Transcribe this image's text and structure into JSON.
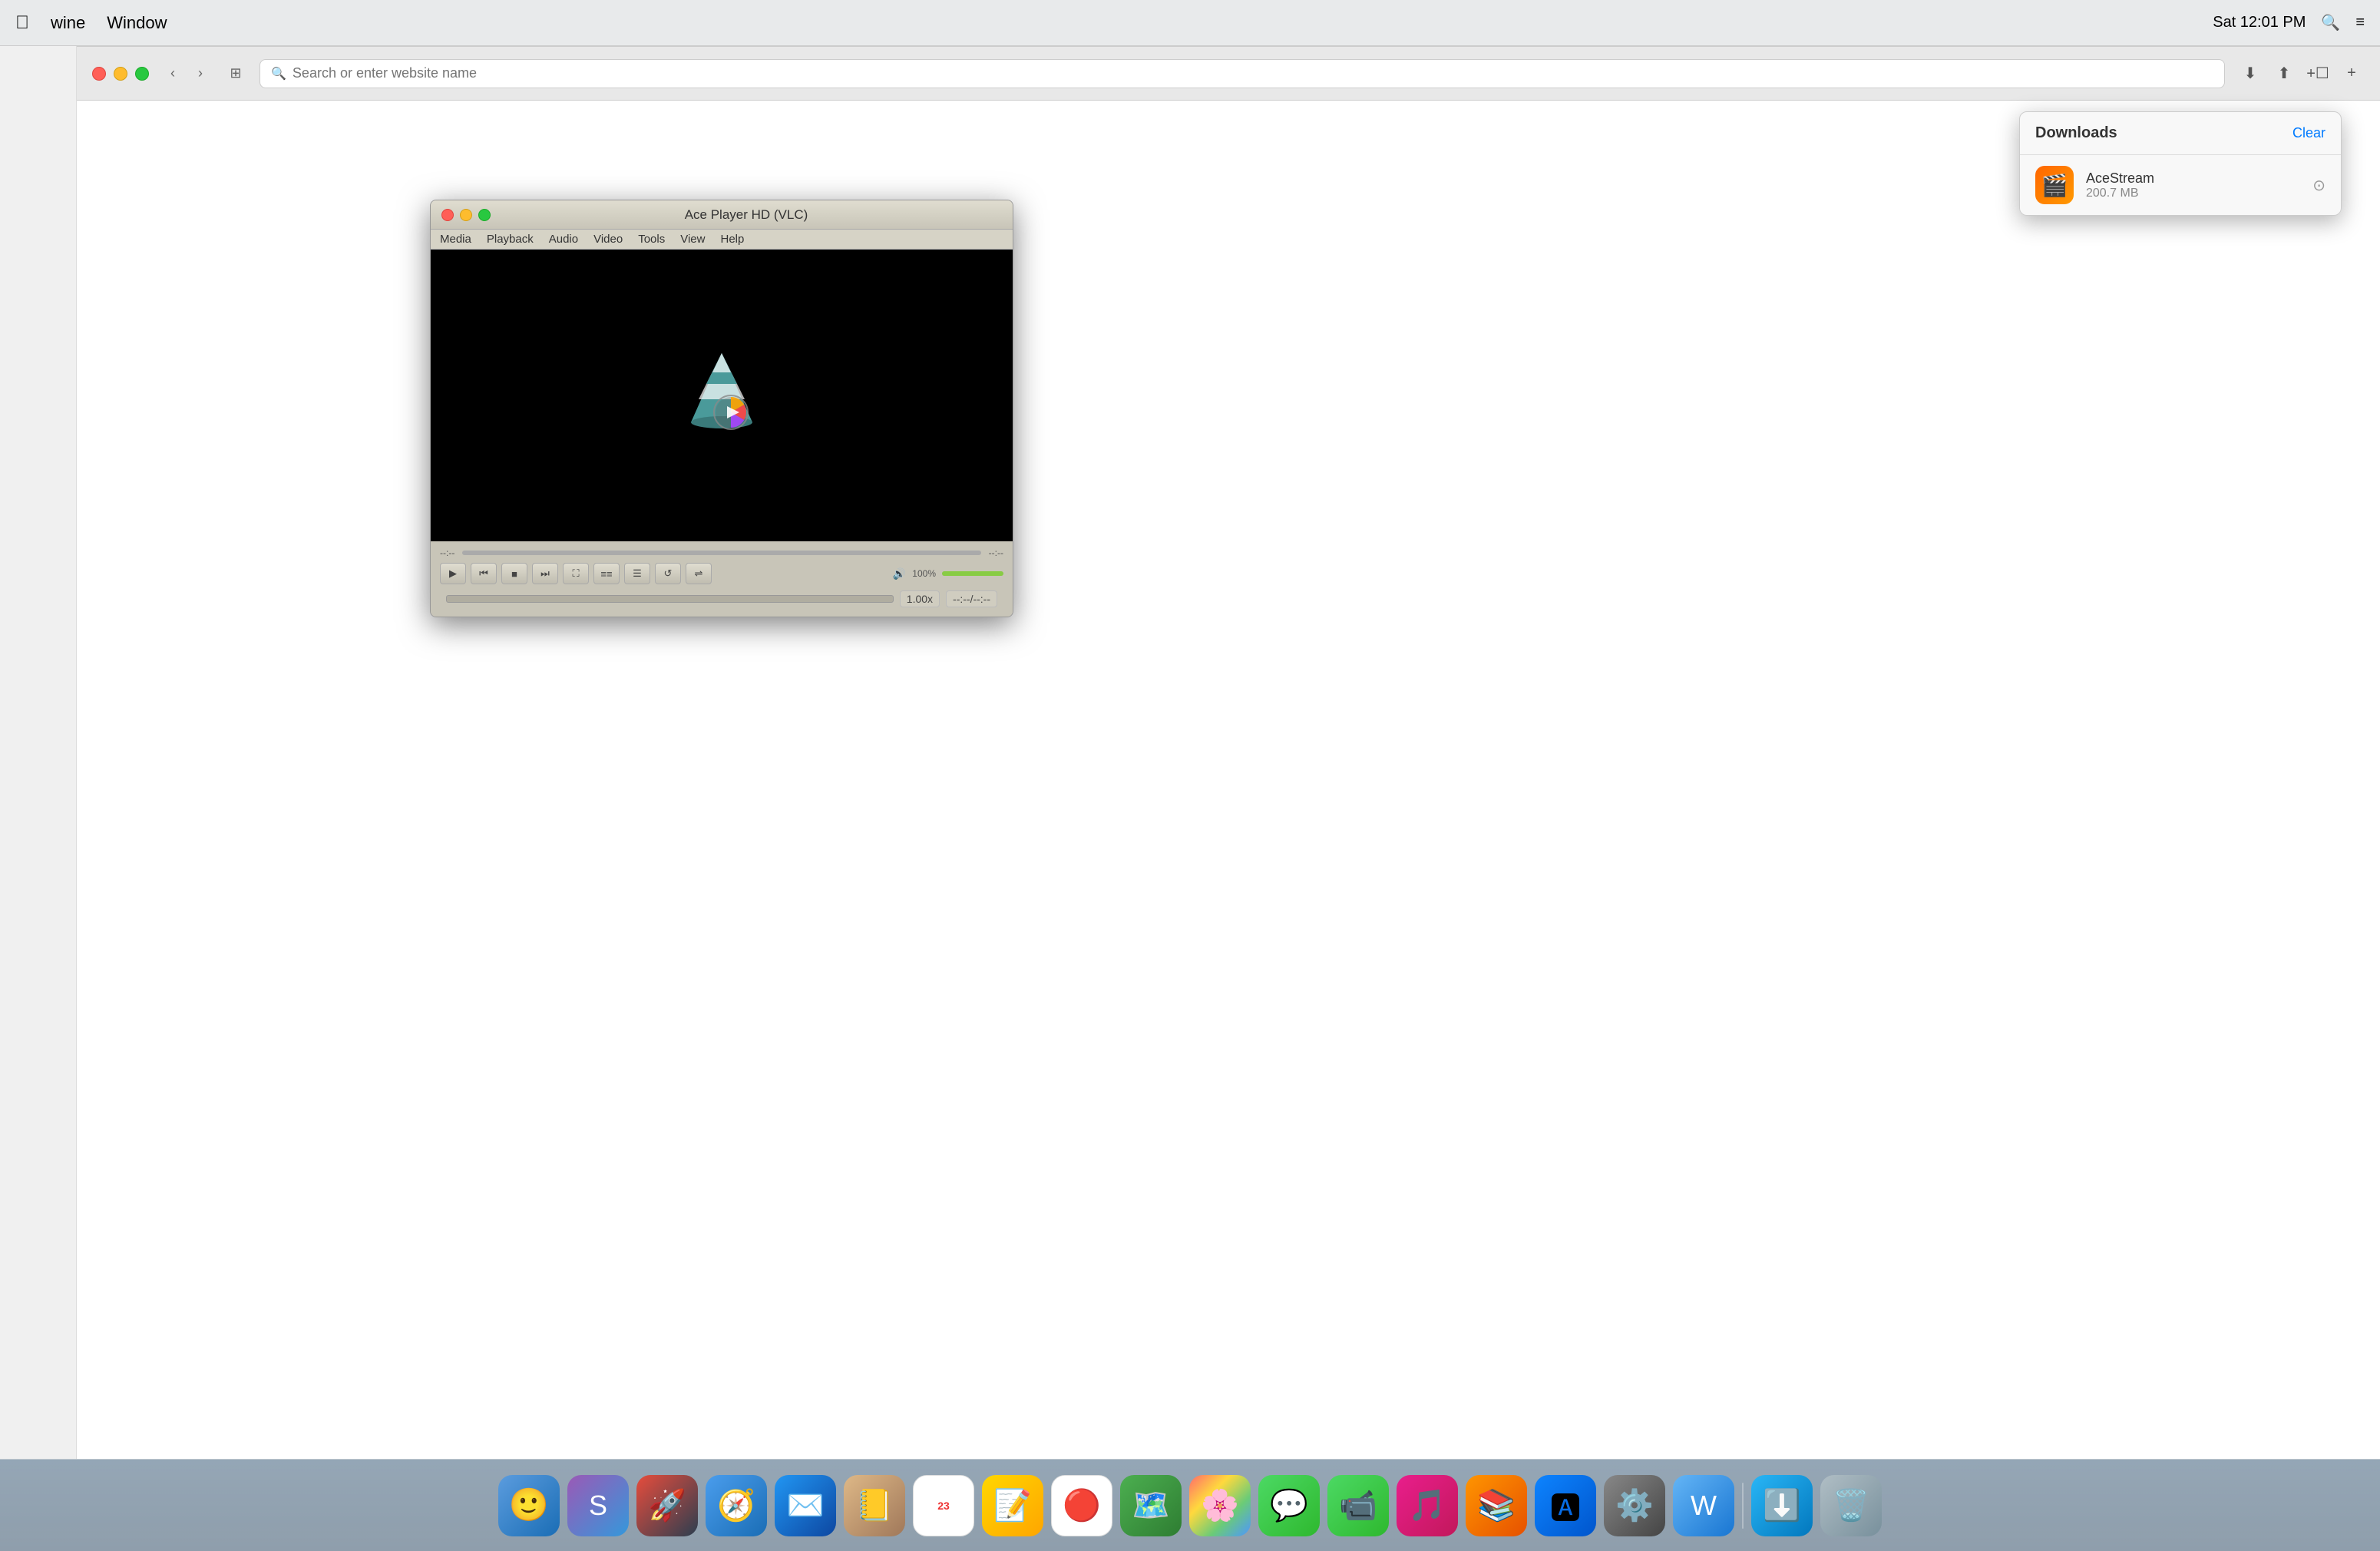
{
  "menubar": {
    "apple_label": "",
    "app_label": "wine",
    "window_label": "Window",
    "time": "Sat 12:01 PM"
  },
  "browser": {
    "search_placeholder": "Search or enter website name",
    "toolbar_buttons": {
      "back": "‹",
      "forward": "›",
      "sidebar": "⊞"
    }
  },
  "downloads": {
    "title": "Downloads",
    "clear_label": "Clear",
    "items": [
      {
        "name": "AceStream",
        "size": "200.7 MB",
        "icon": "🎬"
      }
    ]
  },
  "vlc": {
    "title": "Ace Player HD (VLC)",
    "menu_items": [
      "Media",
      "Playback",
      "Audio",
      "Video",
      "Tools",
      "View",
      "Help"
    ],
    "progress_left": "--:--",
    "progress_right": "--:--",
    "speed": "1.00x",
    "time": "--:--/--:--",
    "volume_label": "100%"
  },
  "dock": {
    "items": [
      {
        "name": "Finder",
        "icon": "🔵"
      },
      {
        "name": "Siri",
        "icon": "🔮"
      },
      {
        "name": "Launchpad",
        "icon": "🚀"
      },
      {
        "name": "Safari",
        "icon": "🧭"
      },
      {
        "name": "Mail",
        "icon": "✉️"
      },
      {
        "name": "Contacts",
        "icon": "📒"
      },
      {
        "name": "Calendar",
        "icon": "📅"
      },
      {
        "name": "Notes",
        "icon": "📝"
      },
      {
        "name": "Reminders",
        "icon": "🔴"
      },
      {
        "name": "Maps",
        "icon": "🗺️"
      },
      {
        "name": "Photos",
        "icon": "🌸"
      },
      {
        "name": "Messages",
        "icon": "💬"
      },
      {
        "name": "FaceTime",
        "icon": "📷"
      },
      {
        "name": "iTunes",
        "icon": "🎵"
      },
      {
        "name": "Books",
        "icon": "📚"
      },
      {
        "name": "App Store",
        "icon": "🅰️"
      },
      {
        "name": "System Preferences",
        "icon": "⚙️"
      },
      {
        "name": "Wine",
        "icon": "🍷"
      },
      {
        "name": "Downloads",
        "icon": "⬇️"
      },
      {
        "name": "Trash",
        "icon": "🗑️"
      }
    ]
  }
}
